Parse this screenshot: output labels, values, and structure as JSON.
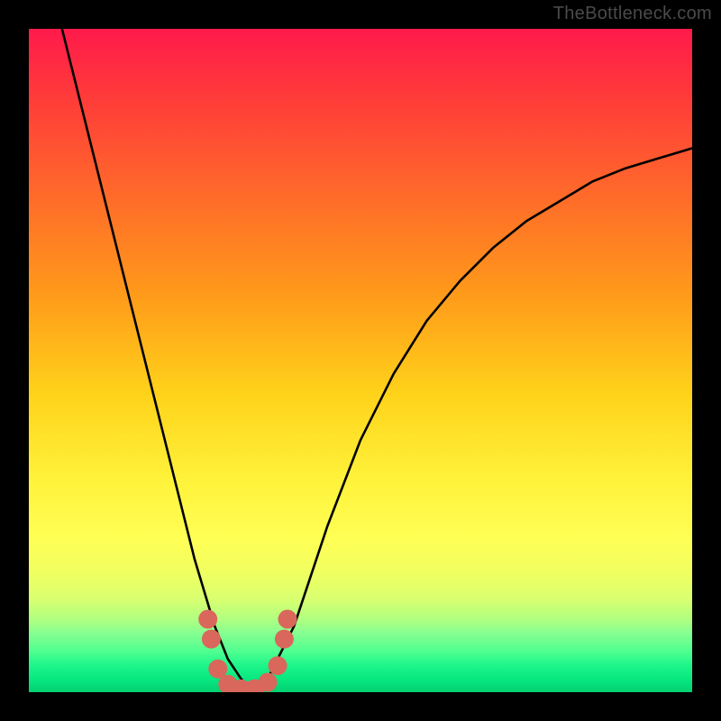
{
  "watermark": "TheBottleneck.com",
  "chart_data": {
    "type": "line",
    "title": "",
    "xlabel": "",
    "ylabel": "",
    "xlim": [
      0,
      100
    ],
    "ylim": [
      0,
      100
    ],
    "grid": false,
    "legend": false,
    "series": [
      {
        "name": "bottleneck-curve",
        "x": [
          5,
          10,
          15,
          20,
          25,
          28,
          30,
          32,
          34,
          36,
          40,
          45,
          50,
          55,
          60,
          65,
          70,
          75,
          80,
          85,
          90,
          95,
          100
        ],
        "y": [
          100,
          80,
          60,
          40,
          20,
          10,
          5,
          2,
          0,
          2,
          10,
          25,
          38,
          48,
          56,
          62,
          67,
          71,
          74,
          77,
          79,
          80.5,
          82
        ]
      }
    ],
    "markers": {
      "name": "bottleneck-dots",
      "color": "#d9675b",
      "points": [
        {
          "x": 27,
          "y": 11
        },
        {
          "x": 27.5,
          "y": 8
        },
        {
          "x": 28.5,
          "y": 3.5
        },
        {
          "x": 30,
          "y": 1.2
        },
        {
          "x": 32,
          "y": 0.5
        },
        {
          "x": 34,
          "y": 0.5
        },
        {
          "x": 36,
          "y": 1.5
        },
        {
          "x": 37.5,
          "y": 4
        },
        {
          "x": 38.5,
          "y": 8
        },
        {
          "x": 39,
          "y": 11
        }
      ]
    },
    "colors": {
      "curve": "#000000",
      "marker": "#d9675b",
      "gradient_top": "#ff1a4b",
      "gradient_mid": "#fff23a",
      "gradient_bottom": "#02d072"
    }
  }
}
